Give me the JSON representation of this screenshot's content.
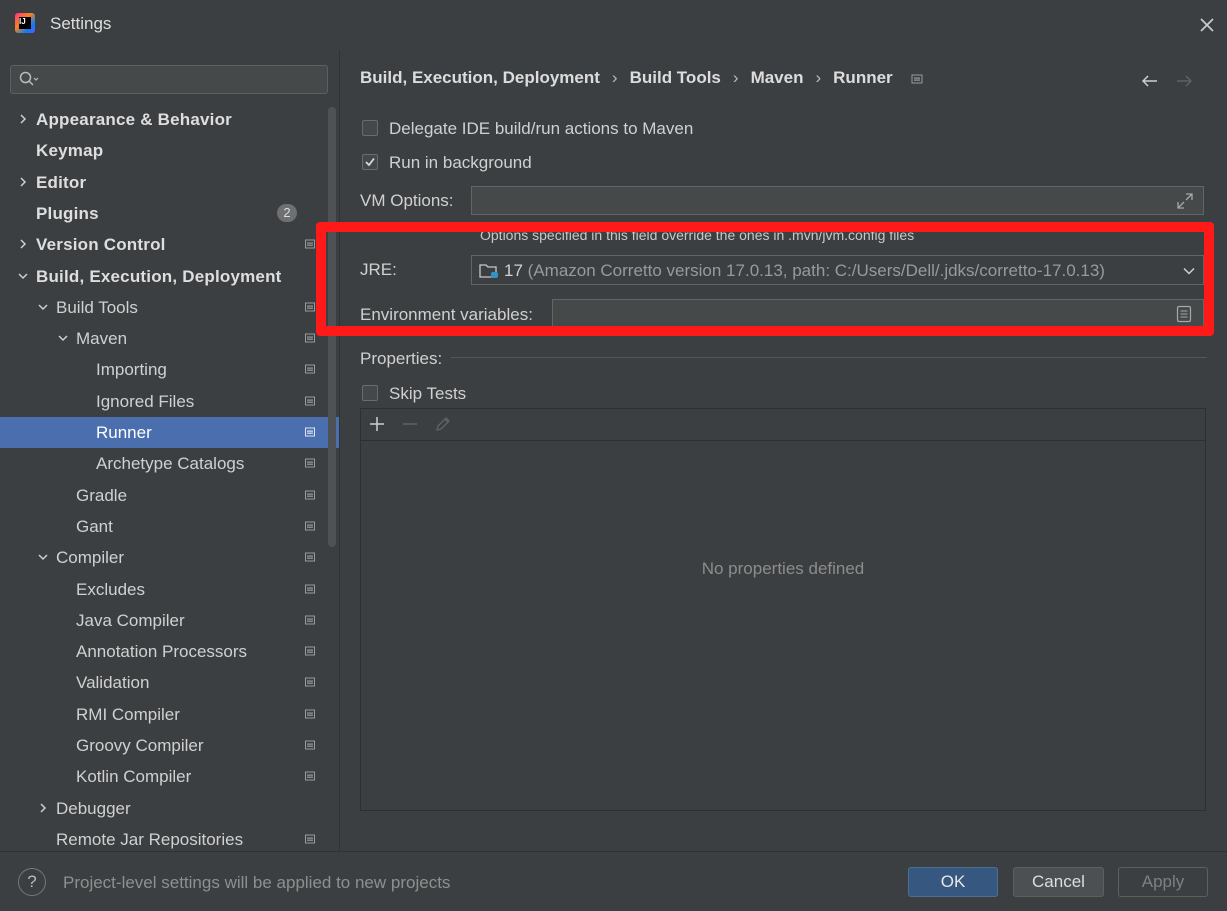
{
  "window": {
    "title": "Settings"
  },
  "search": {
    "placeholder": "",
    "value": ""
  },
  "sidebar": {
    "items": [
      {
        "label": "Appearance & Behavior",
        "level": 0,
        "expander": "collapsed",
        "bold": true,
        "project_icon": false
      },
      {
        "label": "Keymap",
        "level": 0,
        "expander": "none",
        "bold": true,
        "project_icon": false
      },
      {
        "label": "Editor",
        "level": 0,
        "expander": "collapsed",
        "bold": true,
        "project_icon": false
      },
      {
        "label": "Plugins",
        "level": 0,
        "expander": "none",
        "bold": true,
        "badge": "2",
        "project_icon": false
      },
      {
        "label": "Version Control",
        "level": 0,
        "expander": "collapsed",
        "bold": true,
        "project_icon": true
      },
      {
        "label": "Build, Execution, Deployment",
        "level": 0,
        "expander": "expanded",
        "bold": true,
        "project_icon": false
      },
      {
        "label": "Build Tools",
        "level": 1,
        "expander": "expanded",
        "project_icon": true
      },
      {
        "label": "Maven",
        "level": 2,
        "expander": "expanded",
        "project_icon": true
      },
      {
        "label": "Importing",
        "level": 3,
        "expander": "none",
        "project_icon": true
      },
      {
        "label": "Ignored Files",
        "level": 3,
        "expander": "none",
        "project_icon": true
      },
      {
        "label": "Runner",
        "level": 3,
        "expander": "none",
        "project_icon": true,
        "selected": true
      },
      {
        "label": "Archetype Catalogs",
        "level": 3,
        "expander": "none",
        "project_icon": true
      },
      {
        "label": "Gradle",
        "level": 2,
        "expander": "none",
        "project_icon": true
      },
      {
        "label": "Gant",
        "level": 2,
        "expander": "none",
        "project_icon": true
      },
      {
        "label": "Compiler",
        "level": 1,
        "expander": "expanded",
        "project_icon": true
      },
      {
        "label": "Excludes",
        "level": 2,
        "expander": "none",
        "project_icon": true
      },
      {
        "label": "Java Compiler",
        "level": 2,
        "expander": "none",
        "project_icon": true
      },
      {
        "label": "Annotation Processors",
        "level": 2,
        "expander": "none",
        "project_icon": true
      },
      {
        "label": "Validation",
        "level": 2,
        "expander": "none",
        "project_icon": true
      },
      {
        "label": "RMI Compiler",
        "level": 2,
        "expander": "none",
        "project_icon": true
      },
      {
        "label": "Groovy Compiler",
        "level": 2,
        "expander": "none",
        "project_icon": true
      },
      {
        "label": "Kotlin Compiler",
        "level": 2,
        "expander": "none",
        "project_icon": true
      },
      {
        "label": "Debugger",
        "level": 1,
        "expander": "collapsed",
        "project_icon": false
      },
      {
        "label": "Remote Jar Repositories",
        "level": 1,
        "expander": "none",
        "project_icon": true
      }
    ]
  },
  "breadcrumb": [
    "Build, Execution, Deployment",
    "Build Tools",
    "Maven",
    "Runner"
  ],
  "runner": {
    "delegate_label": "Delegate IDE build/run actions to Maven",
    "delegate_checked": false,
    "background_label": "Run in background",
    "background_checked": true,
    "vm_options_label": "VM Options:",
    "vm_options_value": "",
    "vm_options_hint": "Options specified in this field override the ones in .mvn/jvm.config files",
    "jre_label": "JRE:",
    "jre_version": "17",
    "jre_detail": "(Amazon Corretto version 17.0.13, path: C:/Users/Dell/.jdks/corretto-17.0.13)",
    "env_label": "Environment variables:",
    "env_value": "",
    "properties_label": "Properties:",
    "skip_tests_label": "Skip Tests",
    "skip_tests_checked": false,
    "empty_text": "No properties defined"
  },
  "footer": {
    "help_label": "?",
    "text": "Project-level settings will be applied to new projects",
    "ok_label": "OK",
    "cancel_label": "Cancel",
    "apply_label": "Apply"
  },
  "colors": {
    "background": "#3c3f41",
    "selection": "#4b6eaf",
    "highlight_box": "#ff1a1a",
    "ok_button": "#365880"
  }
}
